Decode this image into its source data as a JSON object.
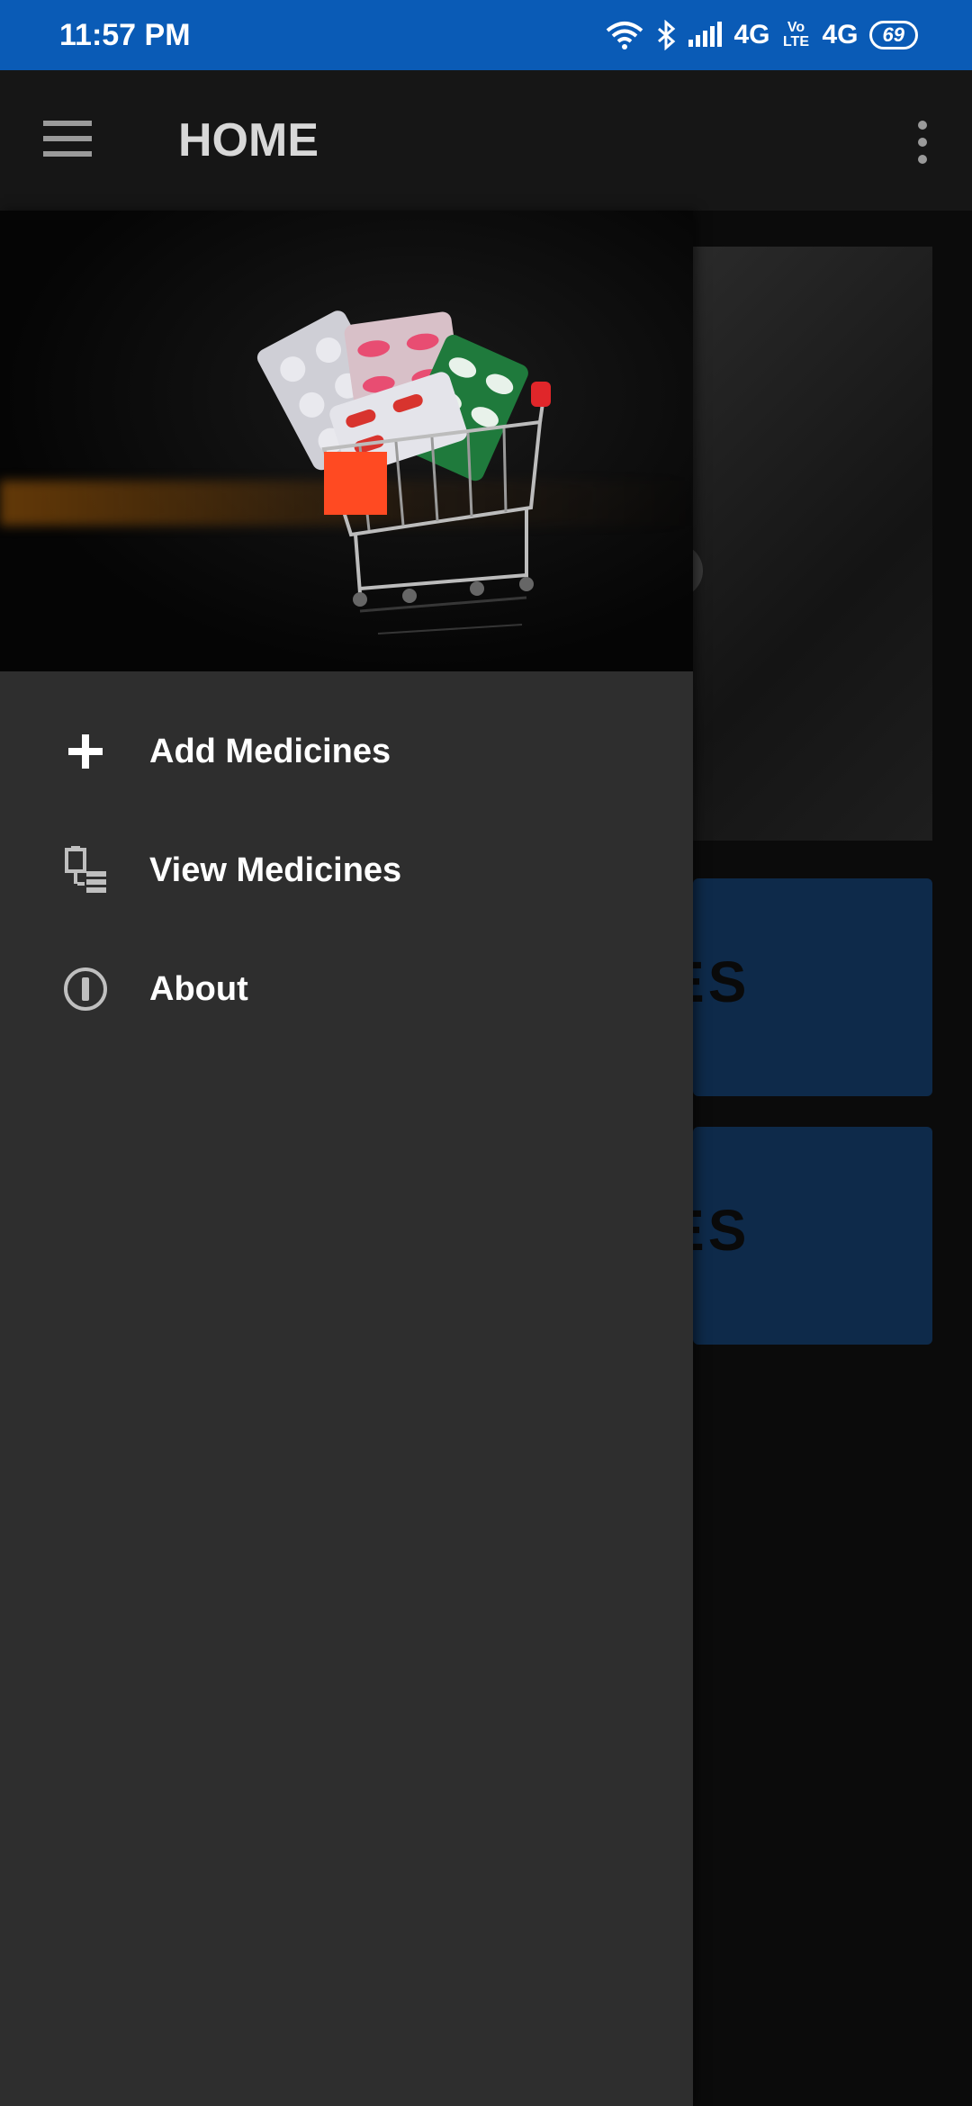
{
  "status_bar": {
    "time": "11:57 PM",
    "network_1": "4G",
    "volte": "Vo LTE",
    "network_2": "4G",
    "battery": "69"
  },
  "app_bar": {
    "title": "HOME",
    "menu_icon": "hamburger-menu-icon",
    "overflow_icon": "more-vertical-icon"
  },
  "drawer": {
    "header_image": "shopping cart with medicine blister packs",
    "items": [
      {
        "label": "Add Medicines",
        "icon": "plus-icon"
      },
      {
        "label": "View Medicines",
        "icon": "list-icon"
      },
      {
        "label": "About",
        "icon": "info-icon"
      }
    ]
  },
  "background": {
    "card_1_peek": "ES",
    "card_2_peek": "ES"
  },
  "colors": {
    "status_bar": "#0a5bb6",
    "app_bar": "#161616",
    "drawer": "#2e2e2e",
    "card": "#0e2a4a"
  }
}
